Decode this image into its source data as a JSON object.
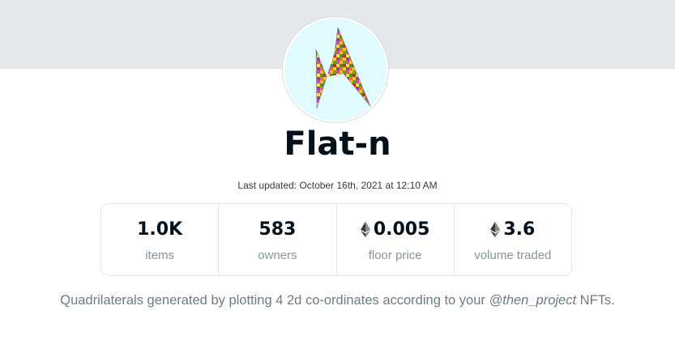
{
  "collection": {
    "name": "Flat-n",
    "last_updated": "Last updated: October 16th, 2021 at 12:10 AM"
  },
  "stats": [
    {
      "value": "1.0K",
      "label": "items",
      "icon": null
    },
    {
      "value": "583",
      "label": "owners",
      "icon": null
    },
    {
      "value": "0.005",
      "label": "floor price",
      "icon": "ethereum-icon"
    },
    {
      "value": "3.6",
      "label": "volume traded",
      "icon": "ethereum-icon"
    }
  ],
  "description": {
    "before": "Quadrilaterals generated by plotting 4 2d co-ordinates according to your ",
    "handle": "@then_project",
    "after": " NFTs."
  },
  "colors": {
    "banner": "#e5e8eb",
    "avatar_bg": "#e0fbff",
    "text_primary": "#04111d",
    "text_secondary": "#8a939b"
  }
}
